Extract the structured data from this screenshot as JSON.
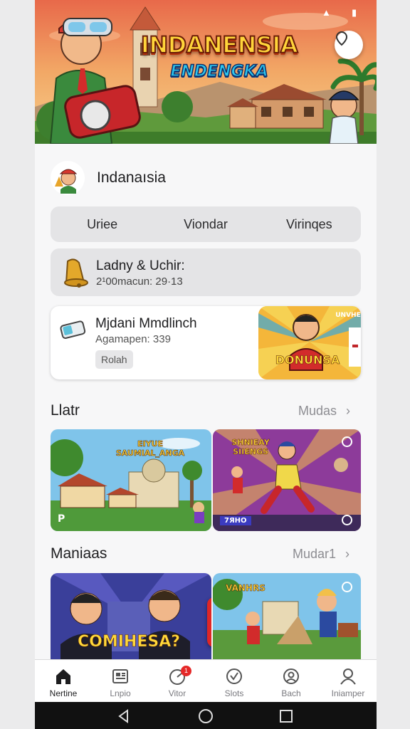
{
  "banner": {
    "title": "INDANENSIA",
    "subtitle": "ENDENGKA",
    "status_icons": [
      "signal-icon",
      "battery-icon"
    ]
  },
  "profile": {
    "name": "Indanaısia"
  },
  "segmented_control": {
    "options": [
      "Uriee",
      "Viondar",
      "Virinqes"
    ]
  },
  "notice": {
    "title": "Ladny & Uchir:",
    "subtitle": "2¹00macun: 29·13",
    "icon": "bell-icon"
  },
  "feature": {
    "title": "Mjdani Mmdlinch",
    "subtitle": "Agamapen: 339",
    "chip": "Rolah",
    "icon": "ticket-icon",
    "thumb_label": "DONUNSA",
    "thumb_badge": "UNVHE"
  },
  "sections": [
    {
      "title": "Llatr",
      "more": "Mudas",
      "tiles": [
        {
          "label": "EIYUE SAUMIAL_ANGA",
          "corner": "P"
        },
        {
          "label": "SHNIEAY SIIENGS",
          "corner": "7ЯНO"
        }
      ]
    },
    {
      "title": "Maniaas",
      "more": "Mudar1",
      "tiles": [
        {
          "label": "COMIHESA?"
        },
        {
          "label": "VANHRS"
        }
      ]
    }
  ],
  "bottom_nav": [
    {
      "label": "Nertine",
      "icon": "home-icon",
      "active": true
    },
    {
      "label": "Lnpio",
      "icon": "news-icon",
      "active": false
    },
    {
      "label": "Vitor",
      "icon": "gauge-icon",
      "active": false,
      "badge": "1"
    },
    {
      "label": "Slots",
      "icon": "check-circle-icon",
      "active": false
    },
    {
      "label": "Bach",
      "icon": "face-icon",
      "active": false
    },
    {
      "label": "Iniamper",
      "icon": "profile-icon",
      "active": false
    }
  ],
  "colors": {
    "accent_red": "#df2626",
    "title_yellow": "#ffd53a",
    "subtitle_cyan": "#2cc6ee"
  }
}
